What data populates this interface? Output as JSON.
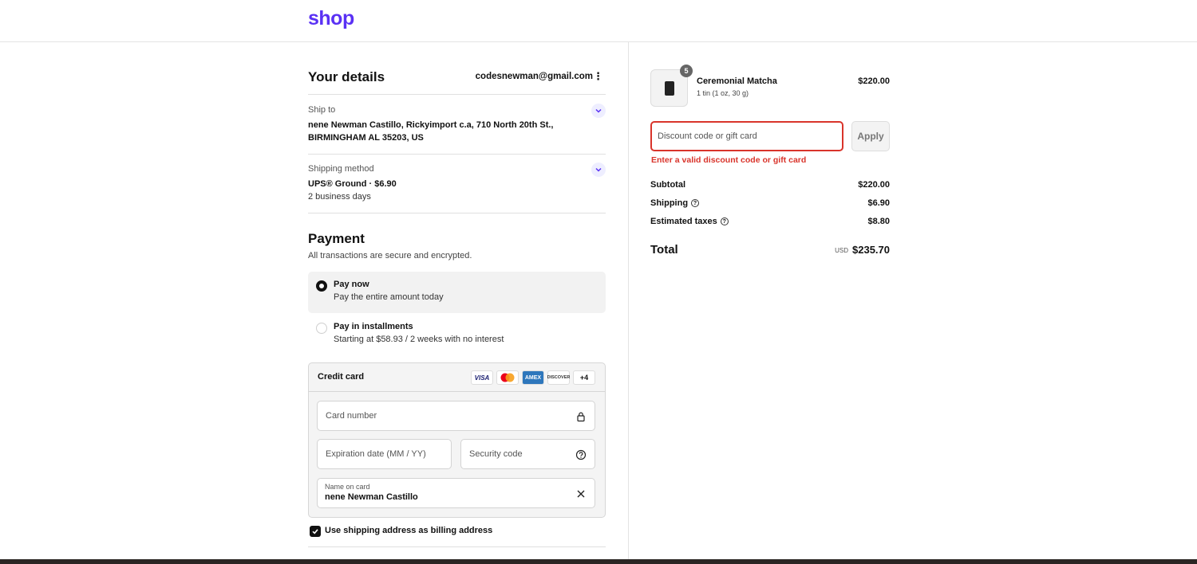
{
  "header": {
    "logo": "shop"
  },
  "details": {
    "title": "Your details",
    "email": "codesnewman@gmail.com",
    "ship_to_label": "Ship to",
    "ship_to_value": "nene Newman Castillo, Rickyimport c.a, 710 North 20th St., BIRMINGHAM AL 35203, US",
    "shipping_method_label": "Shipping method",
    "shipping_method_value": "UPS® Ground · $6.90",
    "shipping_method_sub": "2 business days"
  },
  "payment": {
    "title": "Payment",
    "subtitle": "All transactions are secure and encrypted.",
    "options": [
      {
        "label": "Pay now",
        "sub": "Pay the entire amount today",
        "selected": true
      },
      {
        "label": "Pay in installments",
        "sub": "Starting at $58.93 / 2 weeks with no interest",
        "selected": false
      }
    ],
    "credit_card": {
      "title": "Credit card",
      "brands": [
        "VISA",
        "",
        "AMEX",
        "DISCOVER",
        "+4"
      ],
      "card_number_placeholder": "Card number",
      "expiration_placeholder": "Expiration date (MM / YY)",
      "security_placeholder": "Security code",
      "name_label": "Name on card",
      "name_value": "nene Newman Castillo"
    },
    "billing_checkbox": "Use shipping address as billing address"
  },
  "summary": {
    "product": {
      "quantity": "5",
      "name": "Ceremonial Matcha",
      "variant": "1 tin (1 oz, 30 g)",
      "price": "$220.00"
    },
    "discount": {
      "placeholder": "Discount code or gift card",
      "apply_label": "Apply",
      "error": "Enter a valid discount code or gift card"
    },
    "subtotal_label": "Subtotal",
    "subtotal_value": "$220.00",
    "shipping_label": "Shipping",
    "shipping_value": "$6.90",
    "taxes_label": "Estimated taxes",
    "taxes_value": "$8.80",
    "total_label": "Total",
    "total_currency": "USD",
    "total_value": "$235.70"
  },
  "colors": {
    "brand": "#5a31f4",
    "error": "#d9342b"
  }
}
